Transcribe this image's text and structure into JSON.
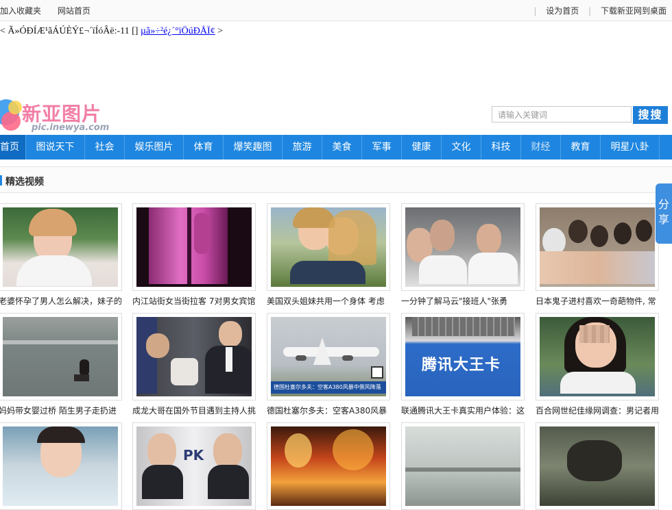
{
  "topbar": {
    "left_links": [
      "加入收藏夹",
      "网站首页"
    ],
    "right_links": [
      "设为首页",
      "下载新亚网到桌面"
    ]
  },
  "garbled_line": {
    "prefix": "< Ã»ÓÐÍÆ¹ãÁÚÈÝ£¬´ïÍóÂë:-11 [] ",
    "link": "µã»÷²é¿´°ïÖúÐÅÏ¢",
    "suffix": " >"
  },
  "logo": {
    "name": "新亚图片",
    "url": "pic.inewya.com"
  },
  "search": {
    "placeholder": "请输入关键词",
    "button": "搜搜"
  },
  "nav": {
    "items": [
      "首页",
      "图说天下",
      "社会",
      "娱乐图片",
      "体育",
      "爆笑趣图",
      "旅游",
      "美食",
      "军事",
      "健康",
      "文化",
      "科技",
      "财经",
      "教育",
      "明星八卦"
    ]
  },
  "section": {
    "title": "精选视频"
  },
  "share": {
    "label": "分享"
  },
  "videos": [
    {
      "caption": "老婆怀孕了男人怎么解决，妹子的"
    },
    {
      "caption": "内江站街女当街拉客 7对男女宾馆"
    },
    {
      "caption": "美国双头姐妹共用一个身体 考虑"
    },
    {
      "caption": "一分钟了解马云\"接班人\"张勇"
    },
    {
      "caption": "日本鬼子进村喜欢一奇葩物件, 常"
    },
    {
      "caption": "妈妈带女婴过桥 陌生男子走扔进"
    },
    {
      "caption": "成龙大哥在国外节目遇到主持人挑"
    },
    {
      "caption": "德国杜塞尔多夫：空客A380风暴"
    },
    {
      "caption": "联通腾讯大王卡真实用户体验：这"
    },
    {
      "caption": "百合网世纪佳缘网调查：男记者用"
    },
    {
      "caption": ""
    },
    {
      "caption": ""
    },
    {
      "caption": ""
    },
    {
      "caption": ""
    },
    {
      "caption": ""
    }
  ],
  "thumb_texts": {
    "pk": "PK",
    "dawangka": "腾讯大王卡",
    "news_banner": "德国杜塞尔多夫：空客A380风暴中侧风降落"
  }
}
